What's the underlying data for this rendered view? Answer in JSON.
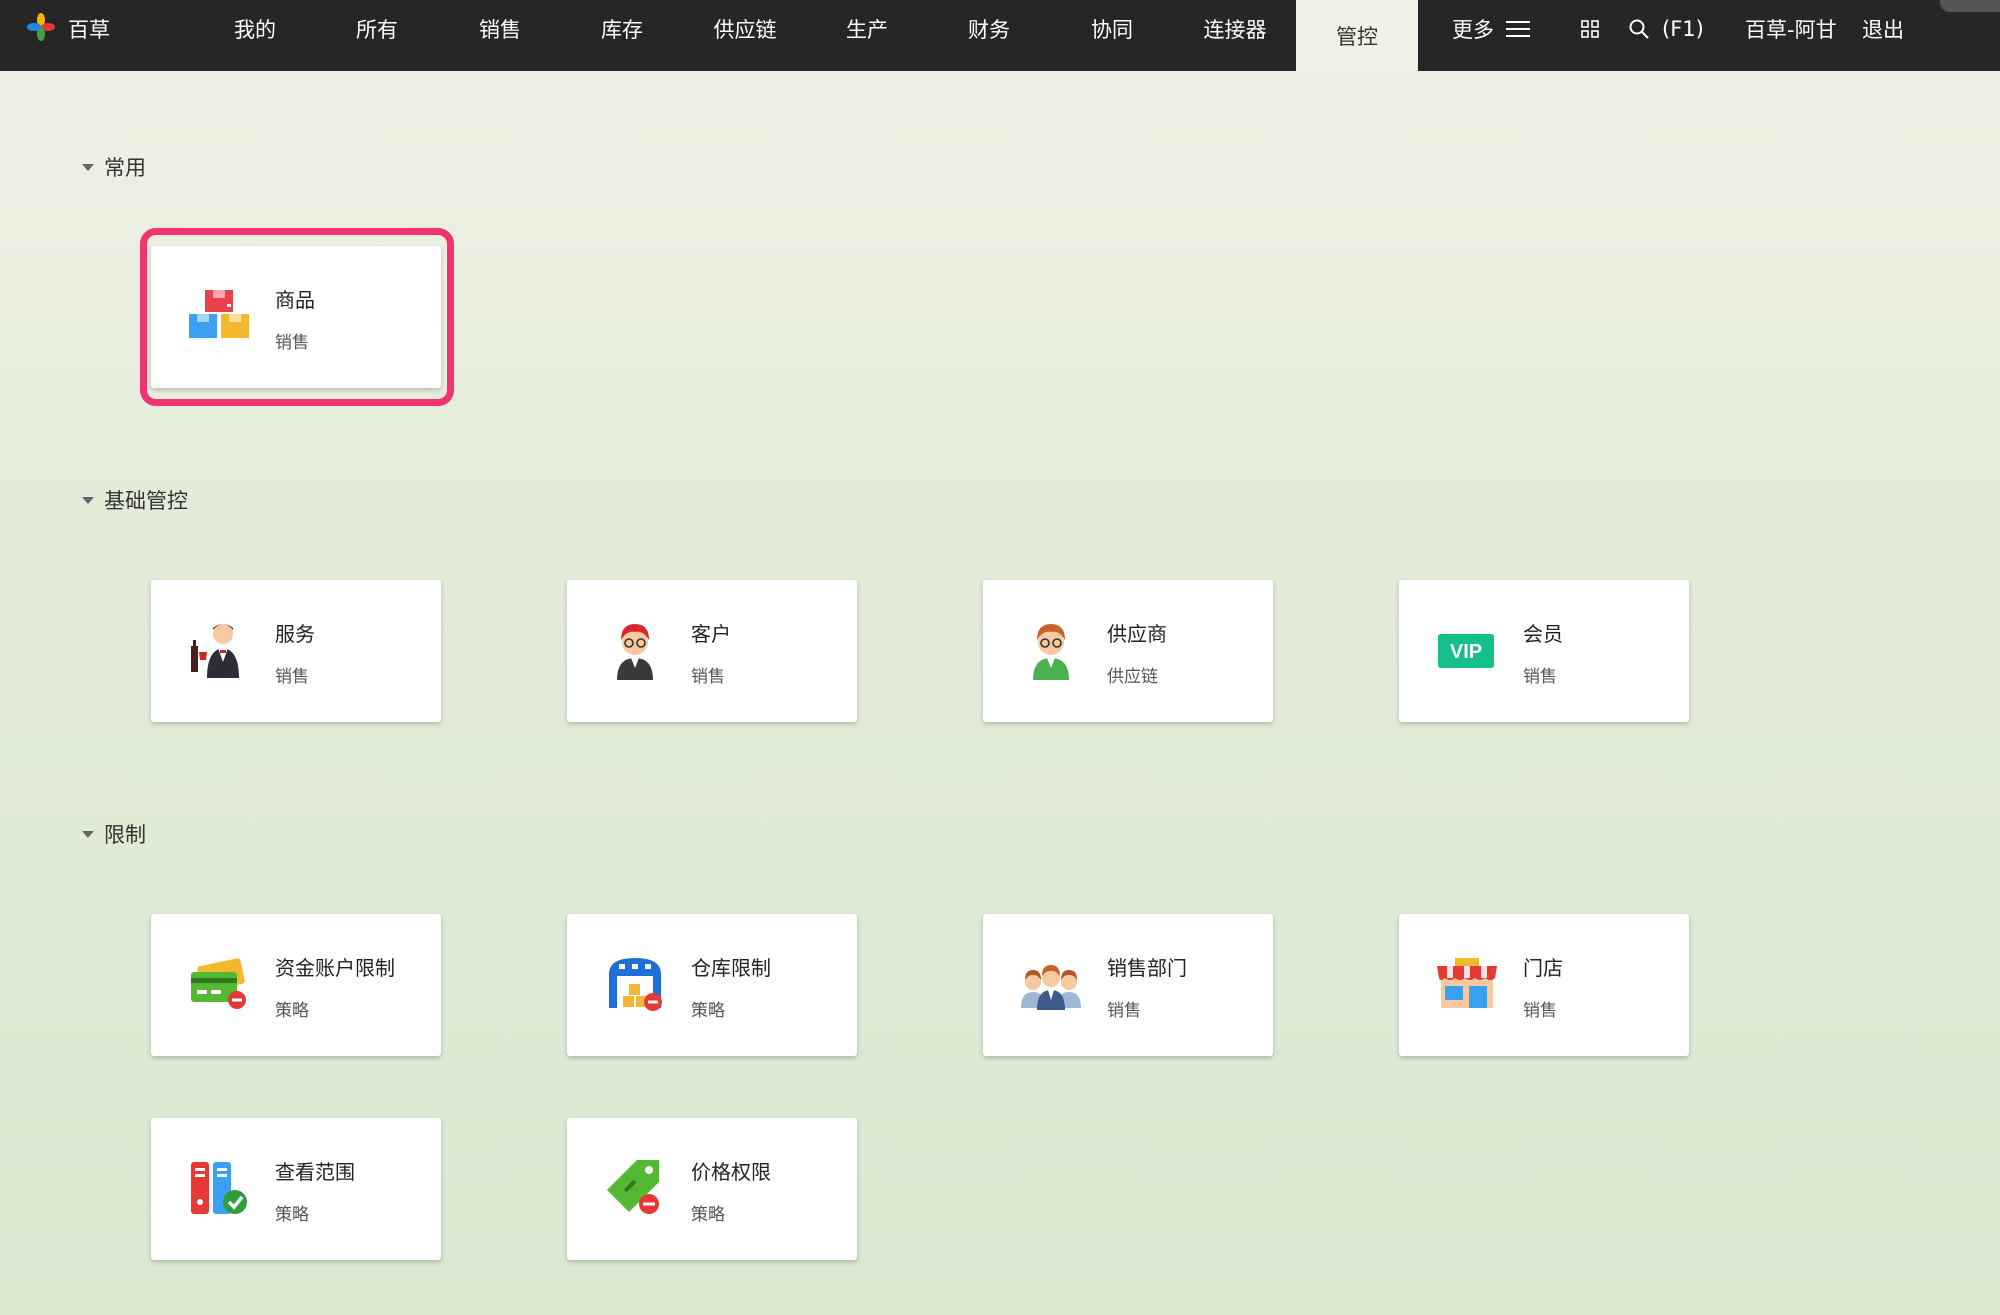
{
  "app": {
    "name": "百草"
  },
  "nav": {
    "items": [
      {
        "label": "我的"
      },
      {
        "label": "所有"
      },
      {
        "label": "销售"
      },
      {
        "label": "库存"
      },
      {
        "label": "供应链"
      },
      {
        "label": "生产"
      },
      {
        "label": "财务"
      },
      {
        "label": "协同"
      },
      {
        "label": "连接器"
      },
      {
        "label": "管控",
        "active": true
      }
    ],
    "more_label": "更多",
    "search_label": "(F1)",
    "user_label": "百草-阿甘",
    "logout_label": "退出"
  },
  "sections": [
    {
      "label": "常用",
      "cards": [
        {
          "title": "商品",
          "subtitle": "销售",
          "icon": "product-boxes-icon",
          "highlighted": true
        }
      ]
    },
    {
      "label": "基础管控",
      "cards": [
        {
          "title": "服务",
          "subtitle": "销售",
          "icon": "waiter-icon"
        },
        {
          "title": "客户",
          "subtitle": "销售",
          "icon": "customer-avatar-icon"
        },
        {
          "title": "供应商",
          "subtitle": "供应链",
          "icon": "supplier-avatar-icon"
        },
        {
          "title": "会员",
          "subtitle": "销售",
          "icon": "vip-badge-icon",
          "icon_text": "VIP"
        }
      ]
    },
    {
      "label": "限制",
      "cards": [
        {
          "title": "资金账户限制",
          "subtitle": "策略",
          "icon": "card-restrict-icon"
        },
        {
          "title": "仓库限制",
          "subtitle": "策略",
          "icon": "warehouse-restrict-icon"
        },
        {
          "title": "销售部门",
          "subtitle": "销售",
          "icon": "team-icon"
        },
        {
          "title": "门店",
          "subtitle": "销售",
          "icon": "store-icon"
        },
        {
          "title": "查看范围",
          "subtitle": "策略",
          "icon": "files-check-icon"
        },
        {
          "title": "价格权限",
          "subtitle": "策略",
          "icon": "price-tag-restrict-icon"
        }
      ]
    }
  ],
  "colors": {
    "topbar": "#262626",
    "highlight": "#f03470",
    "vip": "#14c08a"
  }
}
